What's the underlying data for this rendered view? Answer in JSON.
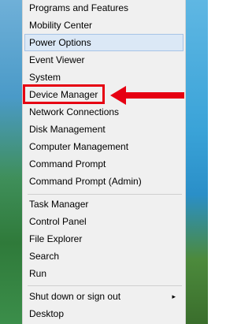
{
  "menu": {
    "items_top": [
      {
        "label": "Programs and Features"
      },
      {
        "label": "Mobility Center"
      },
      {
        "label": "Power Options"
      },
      {
        "label": "Event Viewer"
      },
      {
        "label": "System"
      },
      {
        "label": "Device Manager"
      },
      {
        "label": "Network Connections"
      },
      {
        "label": "Disk Management"
      },
      {
        "label": "Computer Management"
      },
      {
        "label": "Command Prompt"
      },
      {
        "label": "Command Prompt (Admin)"
      }
    ],
    "items_middle": [
      {
        "label": "Task Manager"
      },
      {
        "label": "Control Panel"
      },
      {
        "label": "File Explorer"
      },
      {
        "label": "Search"
      },
      {
        "label": "Run"
      }
    ],
    "items_bottom": [
      {
        "label": "Shut down or sign out"
      },
      {
        "label": "Desktop"
      }
    ],
    "submenu_arrow_glyph": "▸",
    "highlighted_item": "Power Options",
    "highlight_color": "#dbe8f6"
  },
  "annotation": {
    "callout_target": "Device Manager",
    "callout_color": "#e60012",
    "arrow_direction": "left"
  }
}
